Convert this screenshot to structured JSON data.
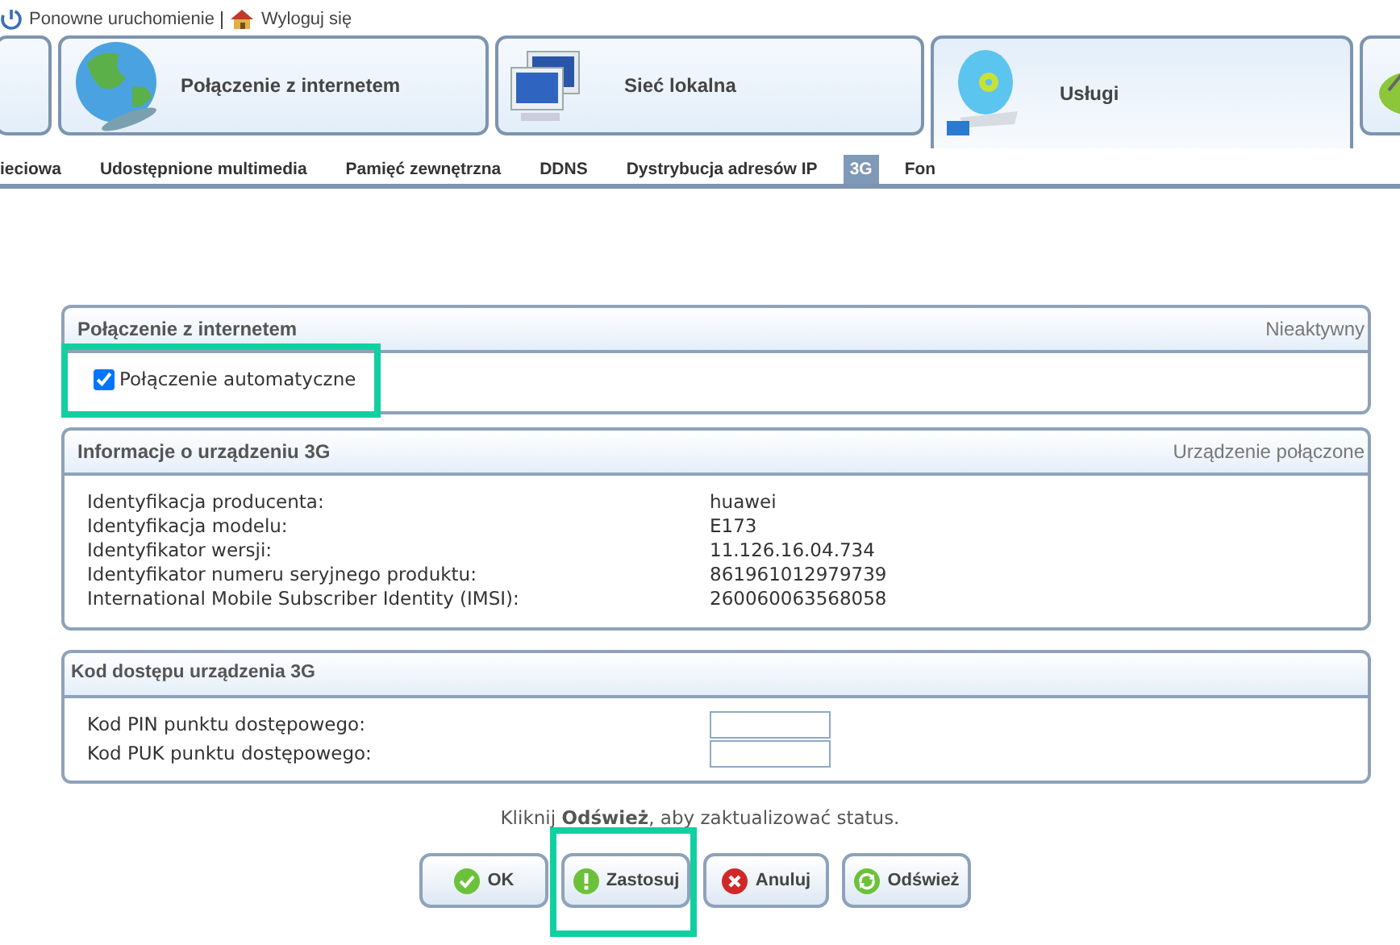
{
  "top_links": [
    {
      "kind": "restart",
      "label": "Ponowne uruchomienie"
    },
    {
      "kind": "logout",
      "label": "Wyloguj się"
    }
  ],
  "main_tabs": [
    {
      "kind": "globe",
      "label": "Połączenie z internetem",
      "selected": false
    },
    {
      "kind": "network",
      "label": "Sieć lokalna",
      "selected": false
    },
    {
      "kind": "disc",
      "label": "Usługi",
      "selected": true
    }
  ],
  "sub_tabs": [
    {
      "label": "ieciowa",
      "selected": false
    },
    {
      "label": "Udostępnione multimedia",
      "selected": false
    },
    {
      "label": "Pamięć zewnętrzna",
      "selected": false
    },
    {
      "label": "DDNS",
      "selected": false
    },
    {
      "label": "Dystrybucja adresów IP",
      "selected": false
    },
    {
      "label": "3G",
      "selected": true
    },
    {
      "label": "Fon",
      "selected": false
    }
  ],
  "panels": [
    {
      "kind": "checkbox",
      "title": "Połączenie z internetem",
      "status": "Nieaktywny",
      "checkbox": {
        "label": "Połączenie automatyczne",
        "checked": true,
        "highlighted": true
      }
    },
    {
      "kind": "info",
      "title": "Informacje o urządzeniu 3G",
      "status": "Urządzenie połączone",
      "rows": [
        {
          "label": "Identyfikacja producenta:",
          "value": "huawei"
        },
        {
          "label": "Identyfikacja modelu:",
          "value": "E173"
        },
        {
          "label": "Identyfikator wersji:",
          "value": "11.126.16.04.734"
        },
        {
          "label": "Identyfikator numeru seryjnego produktu:",
          "value": "861961012979739"
        },
        {
          "label": "International Mobile Subscriber Identity (IMSI):",
          "value": "260060063568058"
        }
      ]
    },
    {
      "kind": "form",
      "title": "Kod dostępu urządzenia 3G",
      "fields": [
        {
          "label": "Kod PIN punktu dostępowego:"
        },
        {
          "label": "Kod PUK punktu dostępowego:"
        }
      ]
    }
  ],
  "hint": "Kliknij **Odśwież**, aby zaktualizować status.",
  "buttons": [
    {
      "kind": "ok",
      "label": "OK",
      "highlighted": false
    },
    {
      "kind": "apply",
      "label": "Zastosuj",
      "highlighted": true
    },
    {
      "kind": "cancel",
      "label": "Anuluj",
      "highlighted": false
    },
    {
      "kind": "refresh",
      "label": "Odśwież",
      "highlighted": false
    }
  ]
}
